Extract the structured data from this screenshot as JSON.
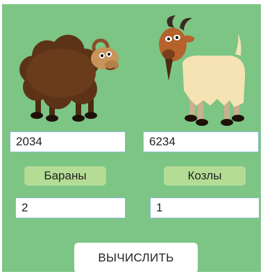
{
  "sheep": {
    "count_input": "2034",
    "label": "Бараны",
    "result": "2",
    "image_icon": "sheep-icon"
  },
  "goat": {
    "count_input": "6234",
    "label": "Козлы",
    "result": "1",
    "image_icon": "goat-icon"
  },
  "calculate_button_label": "ВЫЧИСЛИТЬ",
  "colors": {
    "background": "#7cc585",
    "label_bg": "#b4dc95",
    "sheep_wool": "#5c3317",
    "goat_wool": "#f6e3b4"
  }
}
